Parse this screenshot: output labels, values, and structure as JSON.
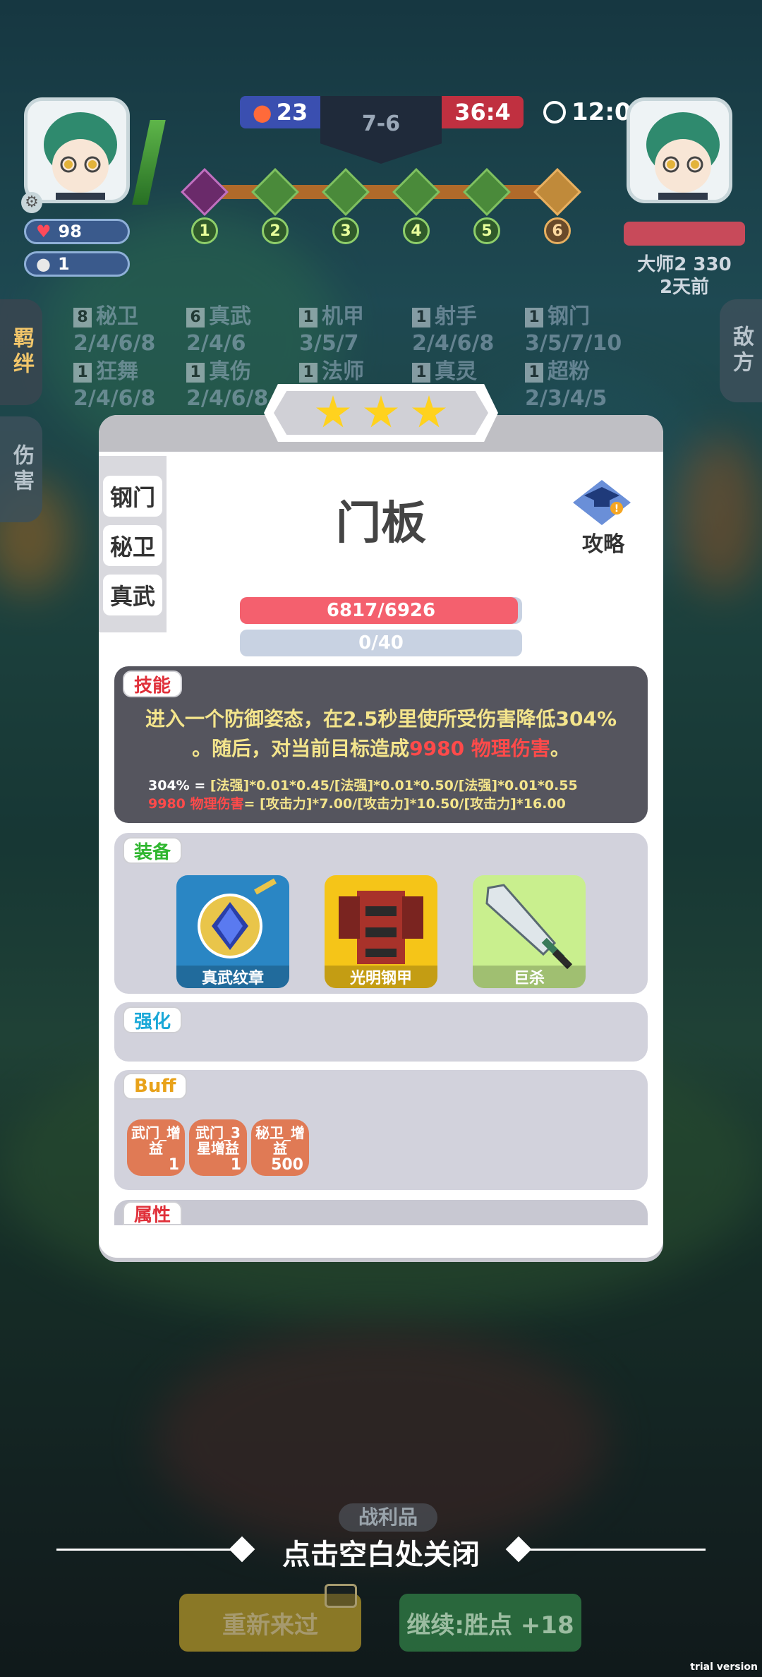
{
  "hud": {
    "hearts": "98",
    "coins": "1",
    "left_score": "23",
    "round": "7-6",
    "right_score": "36:4",
    "timer": "12:0",
    "opponent_rank": "大师2 330",
    "opponent_time": "2天前",
    "stages": [
      "1",
      "2",
      "3",
      "4",
      "5",
      "6"
    ]
  },
  "side_tabs": {
    "bond": "羁绊",
    "damage": "伤害",
    "enemy": "敌方"
  },
  "synergies": [
    {
      "n": "8",
      "name": "秘卫",
      "tiers": "2/4/6/8"
    },
    {
      "n": "6",
      "name": "真武",
      "tiers": "2/4/6"
    },
    {
      "n": "1",
      "name": "机甲",
      "tiers": "3/5/7"
    },
    {
      "n": "1",
      "name": "射手",
      "tiers": "2/4/6/8"
    },
    {
      "n": "1",
      "name": "钢门",
      "tiers": "3/5/7/10"
    },
    {
      "n": "1",
      "name": "狂舞",
      "tiers": "2/4/6/8"
    },
    {
      "n": "1",
      "name": "真伤",
      "tiers": "2/4/6/8"
    },
    {
      "n": "1",
      "name": "法师",
      "tiers": ""
    },
    {
      "n": "1",
      "name": "真灵",
      "tiers": ""
    },
    {
      "n": "1",
      "name": "超粉",
      "tiers": "2/3/4/5"
    }
  ],
  "card": {
    "stars": 3,
    "traits": [
      "钢门",
      "秘卫",
      "真武"
    ],
    "name": "门板",
    "guide_label": "攻略",
    "hp_text": "6817/6926",
    "hp_ratio": 0.984,
    "mana_text": "0/40",
    "mana_ratio": 0
  },
  "skill": {
    "tag": "技能",
    "line1": "进入一个防御姿态，在2.5秒里使所受伤害降低304%",
    "line2_a": "。随后，对当前目标造成",
    "line2_b": "9980 物理伤害",
    "line2_c": "。",
    "formula1_label": "304% = ",
    "formula1": "[法强]*0.01*0.45/[法强]*0.01*0.50/[法强]*0.01*0.55",
    "formula2_label": "9980 物理伤害",
    "formula2": "= [攻击力]*7.00/[攻击力]*10.50/[攻击力]*16.00"
  },
  "equipment": {
    "tag": "装备",
    "items": [
      {
        "name": "真武纹章",
        "bg": "#2a86c4"
      },
      {
        "name": "光明钢甲",
        "bg": "#f5c518"
      },
      {
        "name": "巨杀",
        "bg": "#c9ef8e"
      }
    ]
  },
  "enhance": {
    "tag": "强化"
  },
  "buff": {
    "tag": "Buff",
    "items": [
      {
        "label": "武门_增益",
        "value": "1"
      },
      {
        "label": "武门_3星增益",
        "value": "1"
      },
      {
        "label": "秘卫_增益",
        "value": "500"
      }
    ]
  },
  "attributes": {
    "tag": "属性"
  },
  "close_hint": "点击空白处关闭",
  "faded_label": "战利品",
  "buttons": {
    "retry": "重新来过",
    "continue": "继续:胜点 +18"
  },
  "watermark": "trial version"
}
